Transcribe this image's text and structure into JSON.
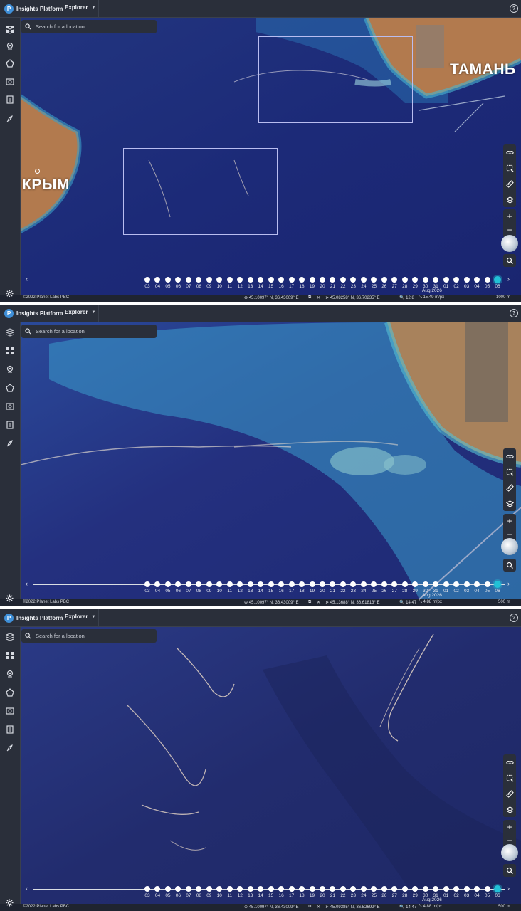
{
  "app": {
    "brand": "Insights Platform",
    "logo_letter": "P",
    "menu": "Explorer",
    "help_icon": "?"
  },
  "search": {
    "placeholder": "Search for a location"
  },
  "sidebar_icons": [
    "layers-stack-icon",
    "grid-icon",
    "location-pin-icon",
    "polygon-icon",
    "image-gallery-icon",
    "document-icon",
    "rocket-icon"
  ],
  "tools": [
    "link-icon",
    "select-area-icon",
    "ruler-icon",
    "layers-icon"
  ],
  "timeline": {
    "days": [
      "03",
      "04",
      "05",
      "06",
      "07",
      "08",
      "09",
      "10",
      "11",
      "12",
      "13",
      "14",
      "15",
      "16",
      "17",
      "18",
      "19",
      "20",
      "21",
      "22",
      "23",
      "24",
      "25",
      "26",
      "27",
      "28",
      "29",
      "30",
      "31",
      "01",
      "02",
      "03",
      "04",
      "05",
      "06"
    ],
    "active_index": 34,
    "month_label": "Aug 2026"
  },
  "panels": [
    {
      "copyright": "©2022 Planet Labs PBC",
      "center_coord": "45.10097° N, 36.43009° E",
      "cursor_coord": "45.08258° N, 36.70235° E",
      "zoom": "12.8",
      "resolution": "15.49 m/px",
      "scale": "1000 m",
      "labels": [
        "КРЫМ",
        "ТАМАНЬ"
      ],
      "colors": {
        "sea_deep": "#1c2a78",
        "sea_shallow": "#2f8fbf",
        "land": "#b27a4e"
      }
    },
    {
      "copyright": "©2022 Planet Labs PBC",
      "center_coord": "45.10097° N, 36.43009° E",
      "cursor_coord": "45.13688° N, 36.61813° E",
      "zoom": "14.47",
      "resolution": "4.88 m/px",
      "scale": "500 m",
      "colors": {
        "sea_deep": "#24307f",
        "sea_shallow": "#3a9ccc",
        "land": "#a8825c"
      }
    },
    {
      "copyright": "©2022 Planet Labs PBC",
      "center_coord": "45.10097° N, 36.43009° E",
      "cursor_coord": "45.09385° N, 36.52692° E",
      "zoom": "14.47",
      "resolution": "4.88 m/px",
      "scale": "500 m",
      "colors": {
        "sea_deep": "#222c6e",
        "sea_shallow": "#2a3a86",
        "land": "#a8825c"
      }
    }
  ]
}
